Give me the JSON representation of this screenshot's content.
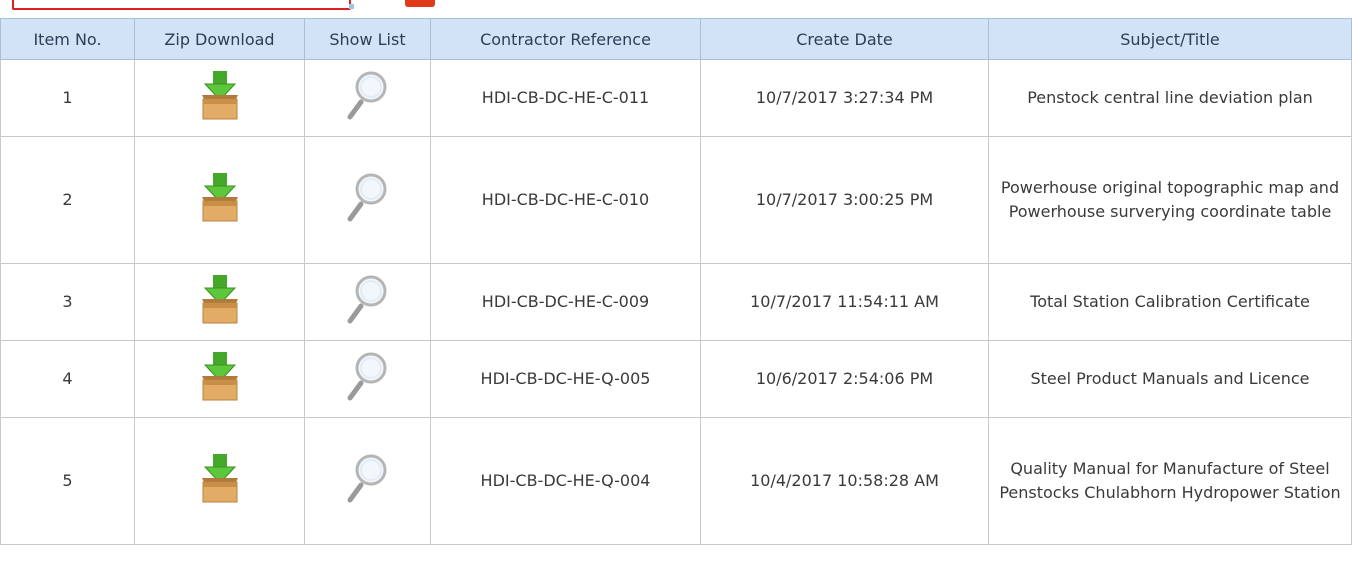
{
  "columns": [
    "Item No.",
    "Zip Download",
    "Show List",
    "Contractor Reference",
    "Create Date",
    "Subject/Title"
  ],
  "rows": [
    {
      "item": "1",
      "reference": "HDI-CB-DC-HE-C-011",
      "date": "10/7/2017 3:27:34 PM",
      "subject": "Penstock central line deviation plan"
    },
    {
      "item": "2",
      "reference": "HDI-CB-DC-HE-C-010",
      "date": "10/7/2017 3:00:25 PM",
      "subject": "Powerhouse original topographic map and Powerhouse surverying coordinate table"
    },
    {
      "item": "3",
      "reference": "HDI-CB-DC-HE-C-009",
      "date": "10/7/2017 11:54:11 AM",
      "subject": "Total Station Calibration Certificate"
    },
    {
      "item": "4",
      "reference": "HDI-CB-DC-HE-Q-005",
      "date": "10/6/2017 2:54:06 PM",
      "subject": "Steel Product Manuals and Licence"
    },
    {
      "item": "5",
      "reference": "HDI-CB-DC-HE-Q-004",
      "date": "10/4/2017 10:58:28 AM",
      "subject": "Quality Manual for Manufacture of Steel Penstocks Chulabhorn Hydropower Station"
    }
  ],
  "icons": {
    "zip": "zip-download-icon",
    "list": "magnifier-icon"
  },
  "colors": {
    "header_bg": "#d3e3f6",
    "accent_red": "#e02020",
    "download_arrow": "#4caf2a",
    "box": "#d9a35c"
  }
}
